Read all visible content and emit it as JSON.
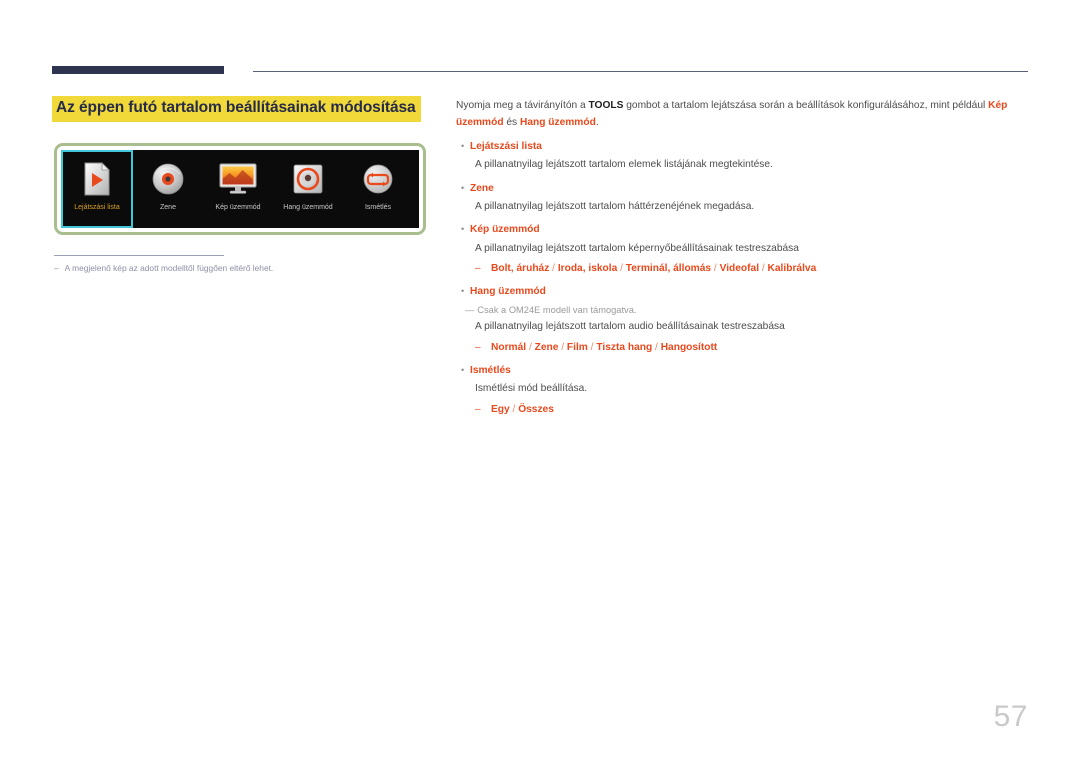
{
  "header": {
    "bar_color": "#2e3350",
    "rule_color": "#5a5f7a"
  },
  "section": {
    "title": "Az éppen futó tartalom beállításainak módosítása",
    "highlight_color": "#f2d93a",
    "title_color": "#262b4a"
  },
  "device_screen": {
    "frame_color": "#a9bd8e",
    "background": "#0b0b0b",
    "selection_color": "#3fc6d8",
    "selected_label_color": "#d9a325",
    "items": [
      {
        "label": "Lejátszási lista",
        "icon": "playlist-document-play-icon",
        "selected": true
      },
      {
        "label": "Zene",
        "icon": "music-disc-icon",
        "selected": false
      },
      {
        "label": "Kép üzemmód",
        "icon": "picture-mode-monitor-icon",
        "selected": false
      },
      {
        "label": "Hang üzemmód",
        "icon": "sound-mode-speaker-icon",
        "selected": false
      },
      {
        "label": "Ismétlés",
        "icon": "repeat-loop-icon",
        "selected": false
      }
    ]
  },
  "left_note": {
    "dash": "‒",
    "text": "A megjelenő kép az adott modelltől függően eltérő lehet."
  },
  "intro": {
    "part1": "Nyomja meg a távirányítón a ",
    "tools": "TOOLS",
    "part2": " gombot a tartalom lejátszása során a beállítások konfigurálásához, mint például ",
    "highlight1": "Kép üzemmód",
    "part3": " és ",
    "highlight2": "Hang üzemmód",
    "part4": "."
  },
  "bullets": [
    {
      "bullet": "•",
      "term": "Lejátszási lista",
      "desc": "A pillanatnyilag lejátszott tartalom elemek listájának megtekintése."
    },
    {
      "bullet": "•",
      "term": "Zene",
      "desc": "A pillanatnyilag lejátszott tartalom háttérzenéjének megadása."
    },
    {
      "bullet": "•",
      "term": "Kép üzemmód",
      "desc": "A pillanatnyilag lejátszott tartalom képernyőbeállításainak testreszabása",
      "sub": {
        "dash": "‒",
        "options": [
          "Bolt, áruház",
          "Iroda, iskola",
          "Terminál, állomás",
          "Videofal",
          "Kalibrálva"
        ],
        "separator": " / "
      }
    },
    {
      "bullet": "•",
      "term": "Hang üzemmód",
      "note": {
        "dash": "―",
        "text": "Csak a OM24E modell van támogatva."
      },
      "desc": "A pillanatnyilag lejátszott tartalom audio beállításainak testreszabása",
      "sub": {
        "dash": "‒",
        "options": [
          "Normál",
          "Zene",
          "Film",
          "Tiszta hang",
          "Hangosított"
        ],
        "separator": " / "
      }
    },
    {
      "bullet": "•",
      "term": "Ismétlés",
      "desc": "Ismétlési mód beállítása.",
      "sub": {
        "dash": "‒",
        "options": [
          "Egy",
          "Összes"
        ],
        "separator": " / "
      }
    }
  ],
  "footer": {
    "page_number": "57",
    "page_number_color": "#c9c9c9"
  },
  "colors": {
    "accent_orange": "#e8491d",
    "body_text": "#4d4d4d",
    "muted": "#9a9a9a"
  }
}
